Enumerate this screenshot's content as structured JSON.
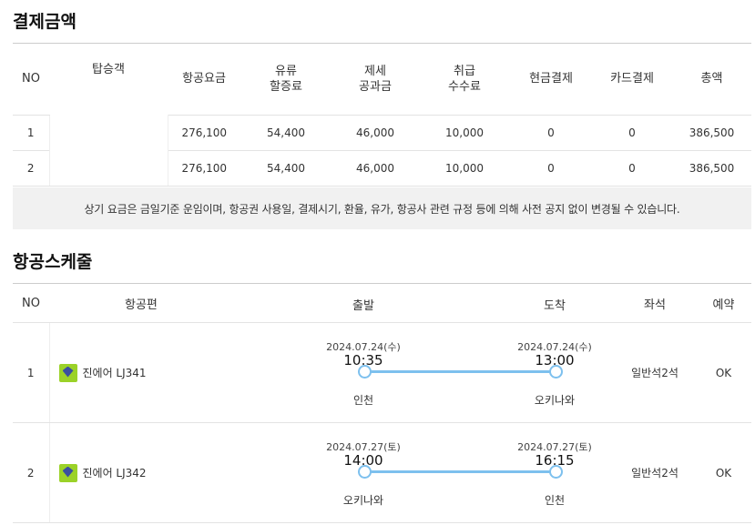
{
  "payment": {
    "title": "결제금액",
    "headers": [
      "NO",
      "탑승객",
      "항공요금",
      "유류\n할증료",
      "제세\n공과금",
      "취급\n수수료",
      "현금결제",
      "카드결제",
      "총액"
    ],
    "rows": [
      [
        "1",
        "",
        "276,100",
        "54,400",
        "46,000",
        "10,000",
        "0",
        "0",
        "386,500"
      ],
      [
        "2",
        "",
        "276,100",
        "54,400",
        "46,000",
        "10,000",
        "0",
        "0",
        "386,500"
      ]
    ]
  },
  "notice": "상기 요금은 금일기준 운임이며, 항공권 사용일, 결제시기, 환율, 유가, 항공사 관련 규정 등에 의해 사전 공지 없이 변경될 수 있습니다.",
  "schedule": {
    "title": "항공스케줄",
    "headers": {
      "no": "NO",
      "flight": "항공편",
      "depart": "출발",
      "arrive": "도착",
      "seat": "좌석",
      "reserve": "예약"
    },
    "rows": [
      {
        "no": "1",
        "airline": "진에어 LJ341",
        "dep_date": "2024.07.24(수)",
        "dep_time": "10:35",
        "dep_city": "인천",
        "arr_date": "2024.07.24(수)",
        "arr_time": "13:00",
        "arr_city": "오키나와",
        "seat": "일반석2석",
        "status": "OK"
      },
      {
        "no": "2",
        "airline": "진에어 LJ342",
        "dep_date": "2024.07.27(토)",
        "dep_time": "14:00",
        "dep_city": "오키나와",
        "arr_date": "2024.07.27(토)",
        "arr_time": "16:15",
        "arr_city": "인천",
        "seat": "일반석2석",
        "status": "OK"
      }
    ]
  },
  "colors": {
    "route_line": "#7dc0ee",
    "notice_bg": "#f1f1f1",
    "airline_logo": "#9bd228"
  }
}
